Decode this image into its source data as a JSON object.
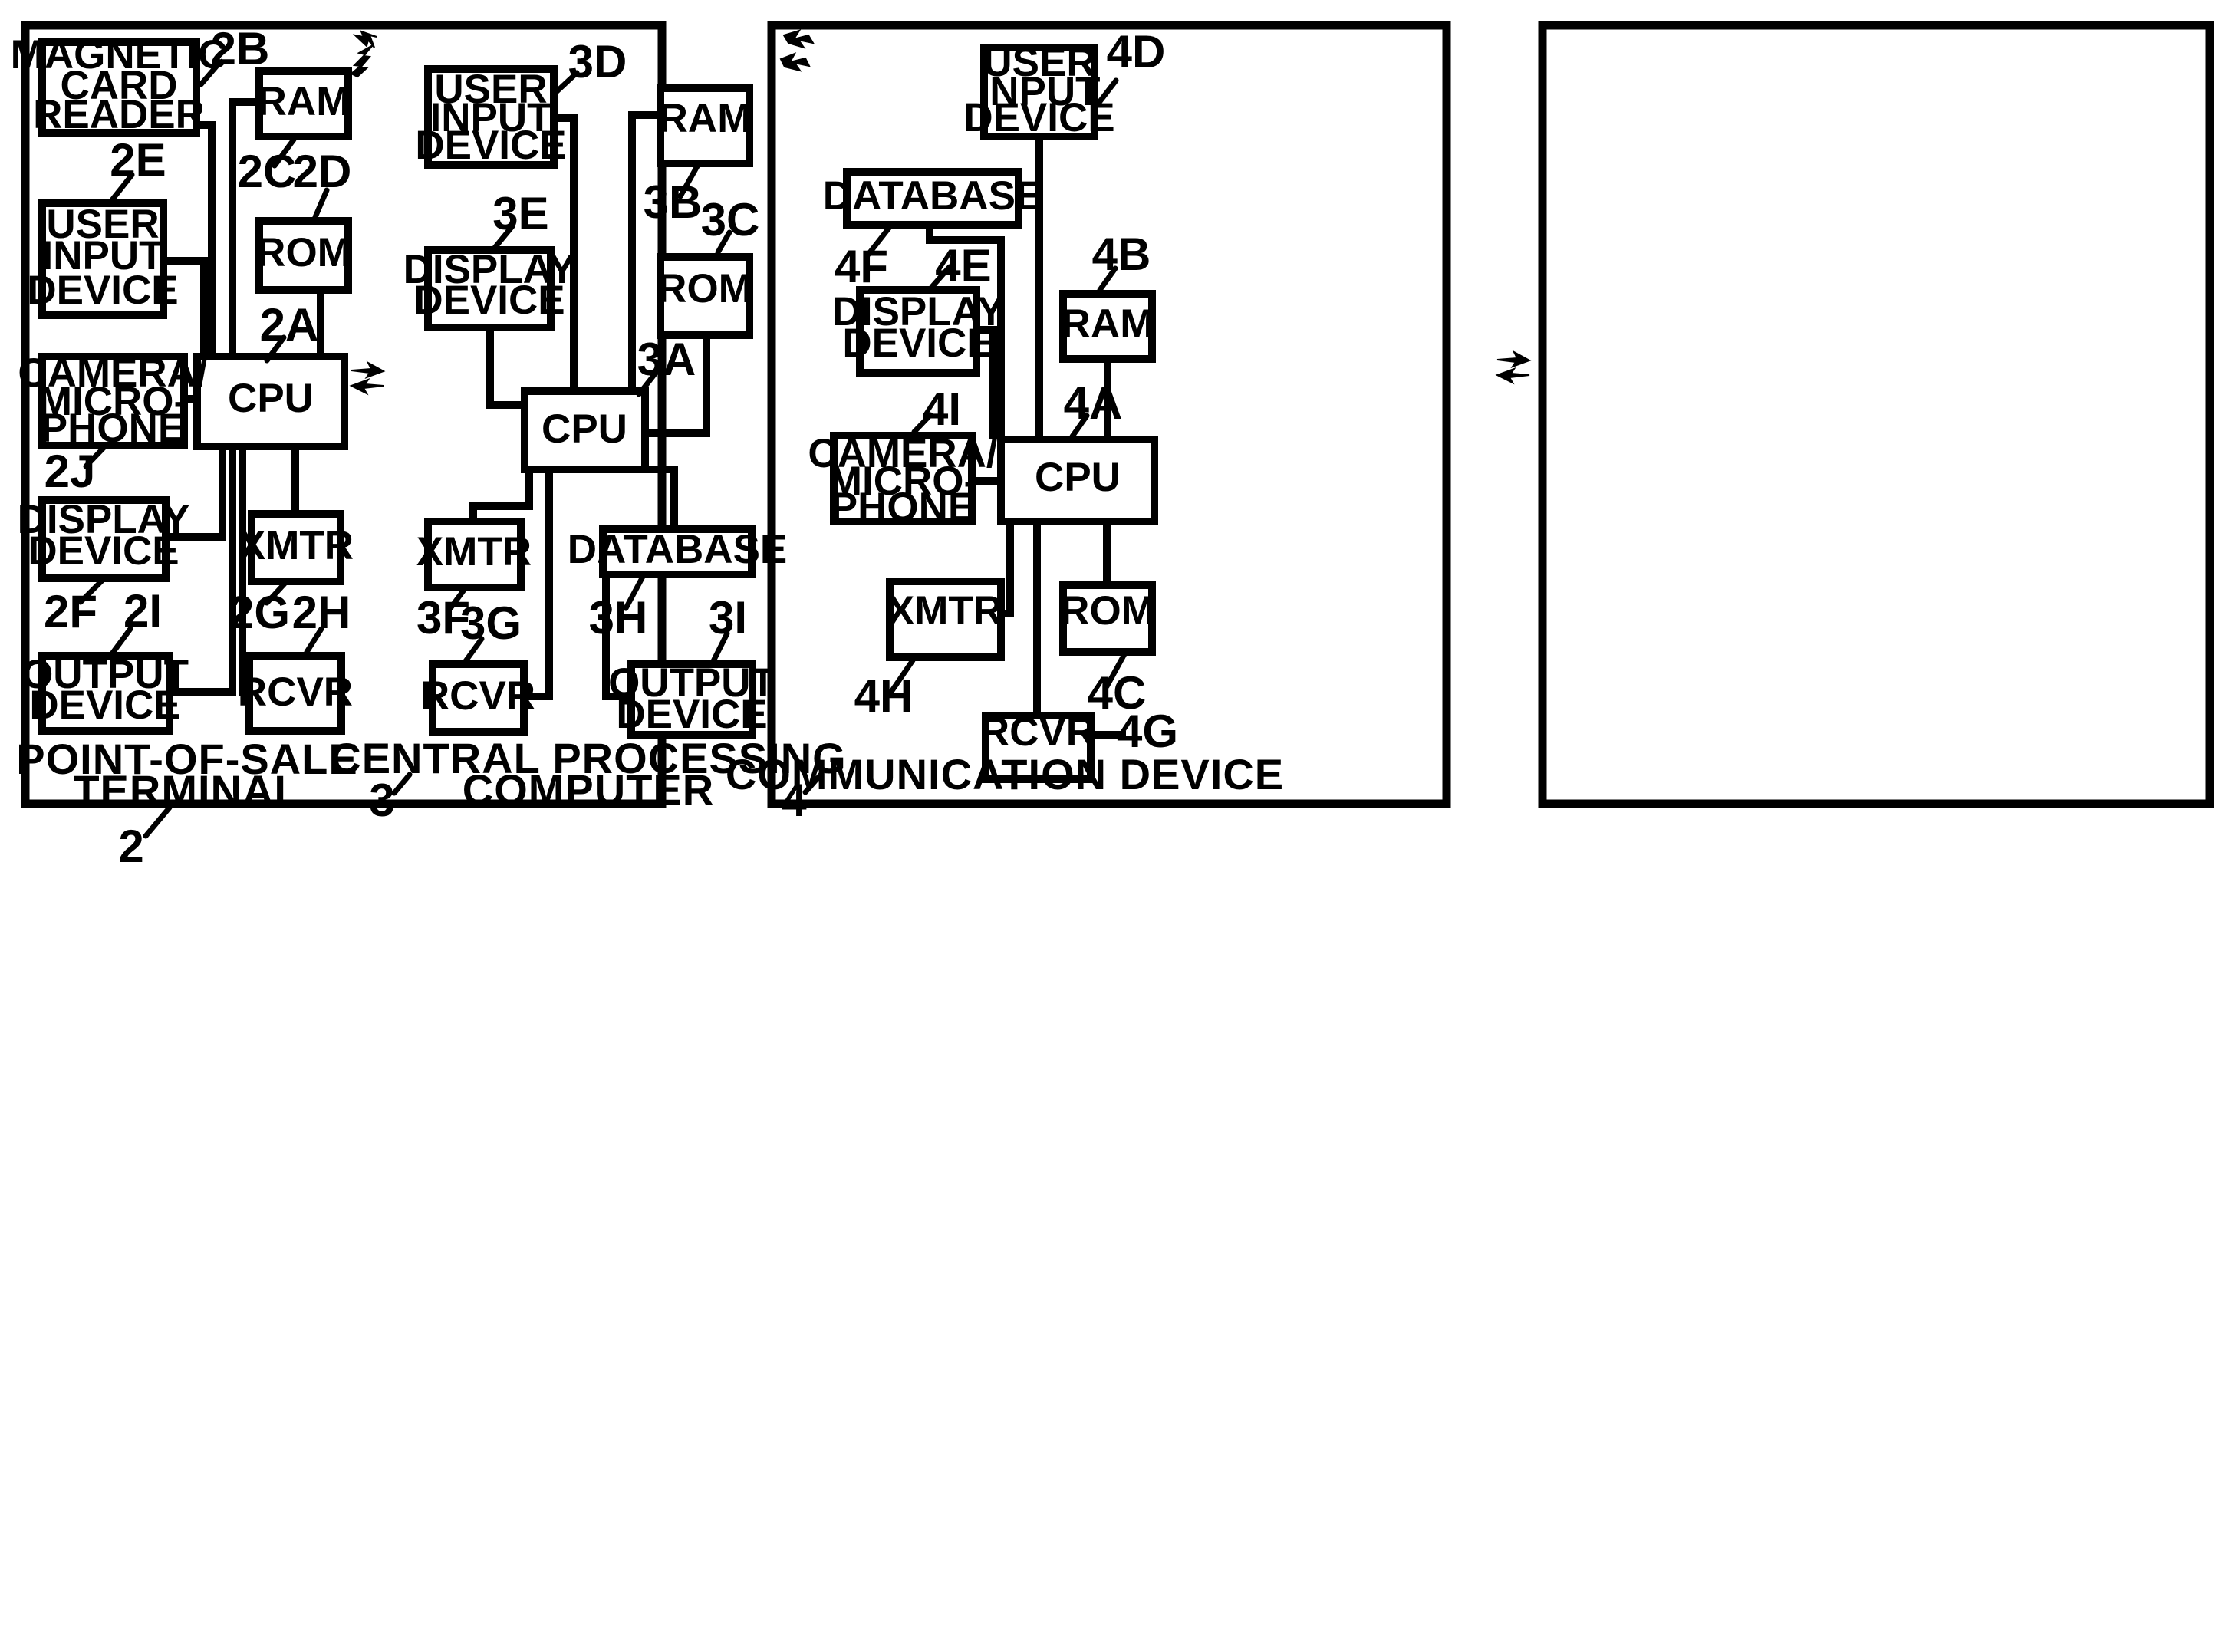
{
  "figure": {
    "type": "patent-block-diagram",
    "background": "#ffffff",
    "line_color": "#000000"
  },
  "panels": [
    {
      "id": "pos-terminal",
      "title_line1": "POINT-OF-SALE",
      "title_line2": "TERMINAL",
      "ref": "2",
      "blocks": [
        {
          "key": "magnetic_card_reader",
          "lines": [
            "MAGNETIC",
            "CARD",
            "READER"
          ],
          "ref": "2B"
        },
        {
          "key": "ram",
          "lines": [
            "RAM"
          ],
          "ref": "2C"
        },
        {
          "key": "rom",
          "lines": [
            "ROM"
          ],
          "ref": "2D"
        },
        {
          "key": "user_input_device",
          "lines": [
            "USER",
            "INPUT",
            "DEVICE"
          ],
          "ref": "2E"
        },
        {
          "key": "cpu",
          "lines": [
            "CPU"
          ],
          "ref": "2A"
        },
        {
          "key": "camera_microphone",
          "lines": [
            "CAMERA/",
            "MICRO-",
            "PHONE"
          ],
          "ref": "2J"
        },
        {
          "key": "display_device",
          "lines": [
            "DISPLAY",
            "DEVICE"
          ],
          "ref": "2F"
        },
        {
          "key": "xmtr",
          "lines": [
            "XMTR"
          ],
          "ref": "2G"
        },
        {
          "key": "output_device",
          "lines": [
            "OUTPUT",
            "DEVICE"
          ],
          "ref": "2I"
        },
        {
          "key": "rcvr",
          "lines": [
            "RCVR"
          ],
          "ref": "2H"
        }
      ]
    },
    {
      "id": "central-processing-computer",
      "title_line1": "CENTRAL PROCESSING",
      "title_line2": "COMPUTER",
      "ref": "3",
      "blocks": [
        {
          "key": "user_input_device",
          "lines": [
            "USER",
            "INPUT",
            "DEVICE"
          ],
          "ref": "3D"
        },
        {
          "key": "ram",
          "lines": [
            "RAM"
          ],
          "ref": "3B"
        },
        {
          "key": "rom",
          "lines": [
            "ROM"
          ],
          "ref": "3C"
        },
        {
          "key": "display_device",
          "lines": [
            "DISPLAY",
            "DEVICE"
          ],
          "ref": "3E"
        },
        {
          "key": "cpu",
          "lines": [
            "CPU"
          ],
          "ref": "3A"
        },
        {
          "key": "xmtr",
          "lines": [
            "XMTR"
          ],
          "ref": "3F"
        },
        {
          "key": "database",
          "lines": [
            "DATABASE"
          ],
          "ref": "3H"
        },
        {
          "key": "rcvr",
          "lines": [
            "RCVR"
          ],
          "ref": "3G"
        },
        {
          "key": "output_device",
          "lines": [
            "OUTPUT",
            "DEVICE"
          ],
          "ref": "3I"
        }
      ]
    },
    {
      "id": "communication-device",
      "title_line1": "COMMUNICATION DEVICE",
      "title_line2": "",
      "ref": "4",
      "blocks": [
        {
          "key": "user_input_device",
          "lines": [
            "USER",
            "INPUT",
            "DEVICE"
          ],
          "ref": "4D"
        },
        {
          "key": "database",
          "lines": [
            "DATABASE"
          ],
          "ref": "4F"
        },
        {
          "key": "display_device",
          "lines": [
            "DISPLAY",
            "DEVICE"
          ],
          "ref": "4E"
        },
        {
          "key": "ram",
          "lines": [
            "RAM"
          ],
          "ref": "4B"
        },
        {
          "key": "camera_microphone",
          "lines": [
            "CAMERA/",
            "MICRO-",
            "PHONE"
          ],
          "ref": "4I"
        },
        {
          "key": "cpu",
          "lines": [
            "CPU"
          ],
          "ref": "4A"
        },
        {
          "key": "xmtr",
          "lines": [
            "XMTR"
          ],
          "ref": "4H"
        },
        {
          "key": "rom",
          "lines": [
            "ROM"
          ],
          "ref": "4C"
        },
        {
          "key": "rcvr",
          "lines": [
            "RCVR"
          ],
          "ref": "4G"
        }
      ]
    }
  ],
  "links": [
    {
      "name": "wireless-link-pos-to-cpc",
      "icon": "lightning-bolt-bidirectional"
    },
    {
      "name": "wireless-link-cpc-to-comm",
      "icon": "lightning-bolt-bidirectional"
    }
  ],
  "labels": {
    "p1": {
      "magnetic_card_reader_l1": "MAGNETIC",
      "magnetic_card_reader_l2": "CARD",
      "magnetic_card_reader_l3": "READER",
      "ram": "RAM",
      "rom": "ROM",
      "user_input_l1": "USER",
      "user_input_l2": "INPUT",
      "user_input_l3": "DEVICE",
      "cpu": "CPU",
      "camera_l1": "CAMERA/",
      "camera_l2": "MICRO-",
      "camera_l3": "PHONE",
      "display_l1": "DISPLAY",
      "display_l2": "DEVICE",
      "xmtr": "XMTR",
      "output_l1": "OUTPUT",
      "output_l2": "DEVICE",
      "rcvr": "RCVR",
      "title1": "POINT-OF-SALE",
      "title2": "TERMINAL",
      "ref_2B": "2B",
      "ref_2C": "2C",
      "ref_2D": "2D",
      "ref_2E": "2E",
      "ref_2A": "2A",
      "ref_2J": "2J",
      "ref_2F": "2F",
      "ref_2I": "2I",
      "ref_2G": "2G",
      "ref_2H": "2H",
      "ref_2": "2"
    },
    "p2": {
      "user_input_l1": "USER",
      "user_input_l2": "INPUT",
      "user_input_l3": "DEVICE",
      "ram": "RAM",
      "rom": "ROM",
      "display_l1": "DISPLAY",
      "display_l2": "DEVICE",
      "cpu": "CPU",
      "xmtr": "XMTR",
      "database": "DATABASE",
      "rcvr": "RCVR",
      "output_l1": "OUTPUT",
      "output_l2": "DEVICE",
      "title1": "CENTRAL PROCESSING",
      "title2": "COMPUTER",
      "ref_3D": "3D",
      "ref_3B": "3B",
      "ref_3C": "3C",
      "ref_3E": "3E",
      "ref_3A": "3A",
      "ref_3F": "3F",
      "ref_3G": "3G",
      "ref_3H": "3H",
      "ref_3I": "3I",
      "ref_3": "3"
    },
    "p3": {
      "user_input_l1": "USER",
      "user_input_l2": "INPUT",
      "user_input_l3": "DEVICE",
      "database": "DATABASE",
      "display_l1": "DISPLAY",
      "display_l2": "DEVICE",
      "ram": "RAM",
      "camera_l1": "CAMERA/",
      "camera_l2": "MICRO-",
      "camera_l3": "PHONE",
      "cpu": "CPU",
      "xmtr": "XMTR",
      "rom": "ROM",
      "rcvr": "RCVR",
      "title1": "COMMUNICATION DEVICE",
      "ref_4D": "4D",
      "ref_4F": "4F",
      "ref_4E": "4E",
      "ref_4B": "4B",
      "ref_4I": "4I",
      "ref_4A": "4A",
      "ref_4H": "4H",
      "ref_4C": "4C",
      "ref_4G": "4G",
      "ref_4": "4"
    }
  }
}
